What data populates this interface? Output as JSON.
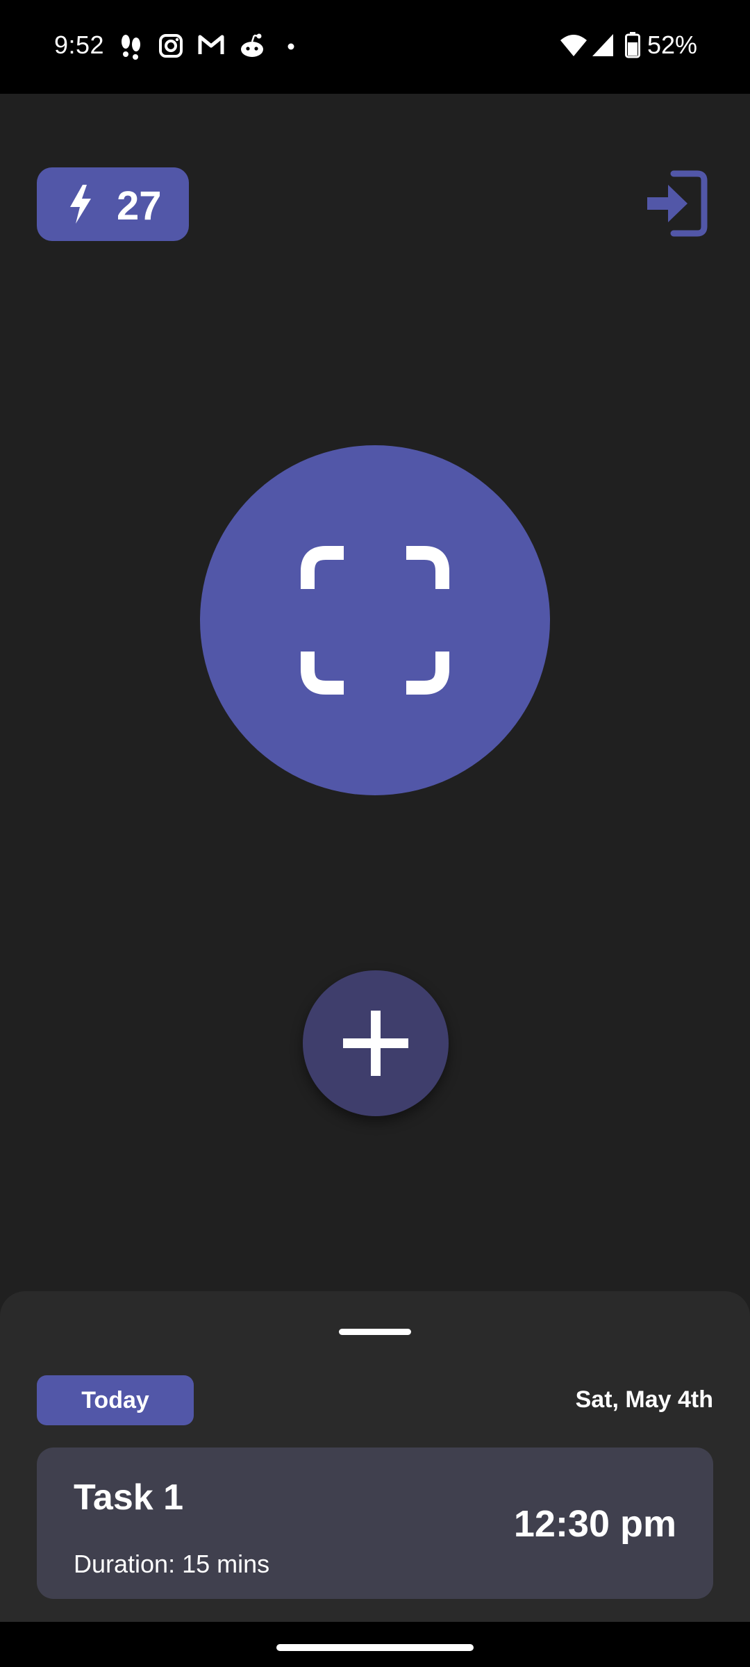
{
  "status_bar": {
    "time": "9:52",
    "battery": "52%",
    "notification_icons": [
      "footsteps-icon",
      "instagram-icon",
      "gmail-icon",
      "reddit-icon",
      "more-dot-icon"
    ],
    "system_icons": [
      "wifi-icon",
      "signal-icon",
      "battery-icon"
    ]
  },
  "header": {
    "streak_count": "27",
    "streak_icon": "lightning-bolt-icon",
    "login_icon": "login-arrow-icon"
  },
  "main": {
    "scan_icon": "scan-frame-icon",
    "add_icon": "plus-icon"
  },
  "schedule": {
    "today_label": "Today",
    "date": "Sat, May 4th",
    "tasks": [
      {
        "title": "Task 1",
        "duration": "Duration: 15 mins",
        "time": "12:30 pm"
      }
    ]
  },
  "colors": {
    "accent": "#5257a8",
    "background": "#202020",
    "sheet": "#2a2a2a",
    "card": "#40404e"
  }
}
